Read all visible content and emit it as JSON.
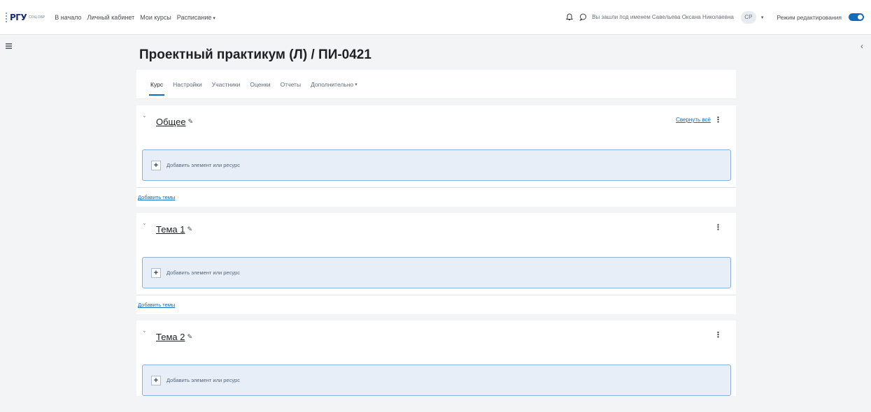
{
  "navbar": {
    "logo_text": "РГУ",
    "logo_sub": "СОЦ.ОБР",
    "links": [
      "В начало",
      "Личный кабинет",
      "Мои курсы",
      "Расписание"
    ],
    "schedule_caret": "▾",
    "login_text": "Вы зашли под именем Савельева Оксана Николаевна",
    "avatar_initials": "СР",
    "edit_mode_label": "Режим редактирования"
  },
  "course": {
    "title": "Проектный практикум (Л) / ПИ-0421",
    "tabs": [
      "Курс",
      "Настройки",
      "Участники",
      "Оценки",
      "Отчеты",
      "Дополнительно"
    ],
    "more_caret": "▾"
  },
  "sections": [
    {
      "title": "Общее",
      "collapse_all": "Свернуть всё",
      "add_label": "Добавить элемент или ресурс",
      "add_topic": "Добавить темы"
    },
    {
      "title": "Тема 1",
      "add_label": "Добавить элемент или ресурс",
      "add_topic": "Добавить темы"
    },
    {
      "title": "Тема 2",
      "add_label": "Добавить элемент или ресурс"
    }
  ],
  "icons": {
    "bell": "bell-icon",
    "chat": "chat-icon",
    "drawer_left": "drawer-icon",
    "drawer_right": "chevron-left-icon",
    "section_chevron": "chevron-down-icon",
    "edit": "pencil-icon",
    "menu": "kebab-icon",
    "add": "plus-icon"
  },
  "colors": {
    "accent": "#0f6cbf",
    "add_box_bg": "#e7eef7",
    "add_box_border": "#8fb0d6"
  }
}
